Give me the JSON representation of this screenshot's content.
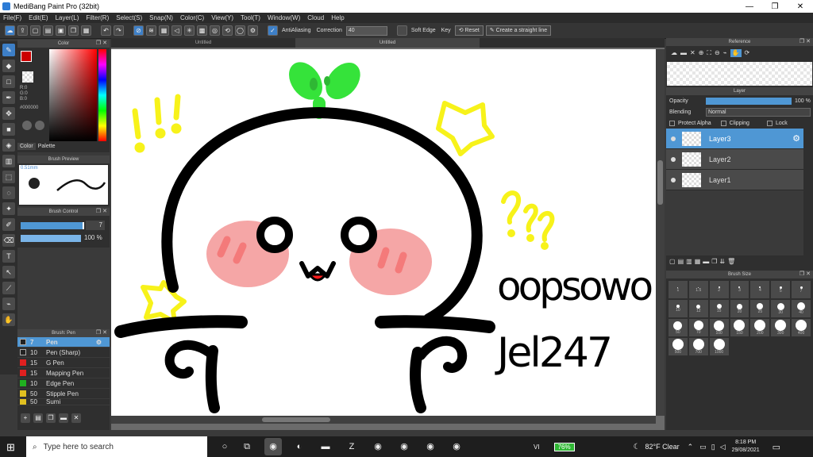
{
  "window": {
    "title": "MediBang Paint Pro (32bit)",
    "minimize": "—",
    "maximize": "❐",
    "close": "✕"
  },
  "menu": [
    "File(F)",
    "Edit(E)",
    "Layer(L)",
    "Filter(R)",
    "Select(S)",
    "Snap(N)",
    "Color(C)",
    "View(Y)",
    "Tool(T)",
    "Window(W)",
    "Cloud",
    "Help"
  ],
  "toolbar": {
    "antialias": "AntiAliasing",
    "correction_label": "Correction",
    "correction_value": "40",
    "soft_edge": "Soft Edge",
    "key": "Key",
    "reset": "Reset",
    "straight_line": "Create a straight line"
  },
  "color_panel": {
    "title": "Color",
    "r": "R:0",
    "g": "G:0",
    "b": "B:0",
    "hex": "#000000",
    "tab_color": "Color",
    "tab_palette": "Palette",
    "primary": "#cc0000",
    "secondary": "#000000"
  },
  "brush_preview": {
    "title": "Brush Preview",
    "size": "0.51mm"
  },
  "brush_control": {
    "title": "Brush Control",
    "size_value": "7",
    "opacity_value": "100 %",
    "size_fraction": 0.98,
    "opacity_fraction": 1.0
  },
  "brush_list": {
    "title": "Brush: Pen",
    "items": [
      {
        "size": "7",
        "name": "Pen",
        "color": "#222222"
      },
      {
        "size": "10",
        "name": "Pen (Sharp)",
        "color": "#222222"
      },
      {
        "size": "15",
        "name": "G Pen",
        "color": "#e02020"
      },
      {
        "size": "15",
        "name": "Mapping Pen",
        "color": "#e02020"
      },
      {
        "size": "10",
        "name": "Edge Pen",
        "color": "#20b020"
      },
      {
        "size": "50",
        "name": "Stipple Pen",
        "color": "#e0c020"
      },
      {
        "size": "50",
        "name": "Sumi",
        "color": "#e0c020"
      }
    ]
  },
  "tabs": [
    "Untitled",
    "Untitled"
  ],
  "canvas": {
    "text_line1": "oopsowo",
    "text_line2": "Jel247"
  },
  "reference": {
    "title": "Reference"
  },
  "layer_panel": {
    "title": "Layer",
    "opacity_label": "Opacity",
    "opacity_value": "100 %",
    "opacity_fraction": 1.0,
    "blending_label": "Blending",
    "blending_value": "Normal",
    "protect_alpha": "Protect Alpha",
    "clipping": "Clipping",
    "lock": "Lock",
    "layers": [
      "Layer3",
      "Layer2",
      "Layer1"
    ]
  },
  "brush_size": {
    "title": "Brush Size",
    "sizes": [
      "1",
      "1.5",
      "2",
      "3",
      "4",
      "5",
      "7",
      "10",
      "12",
      "15",
      "20",
      "25",
      "30",
      "40",
      "50",
      "70",
      "100",
      "150",
      "200",
      "300",
      "400",
      "500",
      "700",
      "1000"
    ]
  },
  "taskbar": {
    "search_placeholder": "Type here to search",
    "battery": "76%",
    "weather": "82°F  Clear",
    "time": "8:18 PM",
    "date": "29/08/2021",
    "lang": "VI"
  }
}
